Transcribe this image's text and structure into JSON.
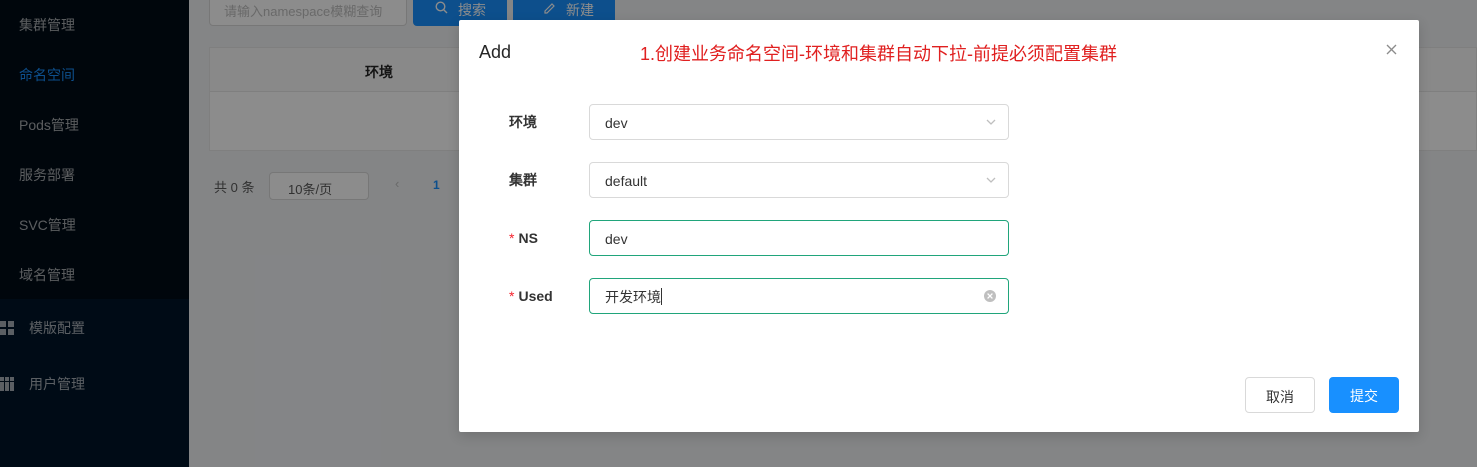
{
  "sidebar": {
    "items": [
      {
        "label": "集群管理",
        "active": false
      },
      {
        "label": "命名空间",
        "active": true
      },
      {
        "label": "Pods管理",
        "active": false
      },
      {
        "label": "服务部署",
        "active": false
      },
      {
        "label": "SVC管理",
        "active": false
      },
      {
        "label": "域名管理",
        "active": false
      }
    ],
    "groups": [
      {
        "label": "模版配置",
        "icon": "apps-icon"
      },
      {
        "label": "用户管理",
        "icon": "table-icon"
      }
    ]
  },
  "toolbar": {
    "search_placeholder": "请输入namespace模糊查询",
    "search_label": "搜索",
    "new_label": "新建"
  },
  "table": {
    "columns": [
      "环境"
    ]
  },
  "pagination": {
    "total": "共 0 条",
    "page_size": "10条/页",
    "prev": "‹",
    "current_page": "1"
  },
  "modal": {
    "title": "Add",
    "annotation": "1.创建业务命名空间-环境和集群自动下拉-前提必须配置集群",
    "fields": [
      {
        "label": "环境",
        "value": "dev",
        "required": false,
        "type": "select"
      },
      {
        "label": "集群",
        "value": "default",
        "required": false,
        "type": "select"
      },
      {
        "label": "NS",
        "value": "dev",
        "required": true,
        "type": "input"
      },
      {
        "label": "Used",
        "value": "开发环境",
        "required": true,
        "type": "input"
      }
    ],
    "required_mark": "*",
    "cancel_label": "取消",
    "submit_label": "提交"
  },
  "colors": {
    "primary": "#1890ff",
    "sidebar_bg": "#001529",
    "annotation": "#e02020",
    "focus_border": "#20a57b"
  }
}
